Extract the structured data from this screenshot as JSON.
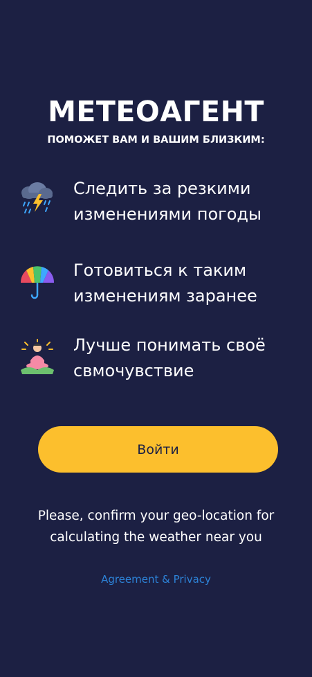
{
  "app": {
    "title": "МЕТЕОАГЕНТ",
    "subtitle": "ПОМОЖЕТ ВАМ И ВАШИМ БЛИЗКИМ:"
  },
  "features": [
    {
      "icon": "thunderstorm-cloud-icon",
      "label": "Следить за резкими изменениями погоды"
    },
    {
      "icon": "rainbow-umbrella-icon",
      "label": "Готовиться к таким изменениям заранее"
    },
    {
      "icon": "meditating-person-icon",
      "label": "Лучше понимать своё свмочувствие"
    }
  ],
  "actions": {
    "login_label": "Войти"
  },
  "geo_note": "Please, confirm your geo-location for calculating the weather near you",
  "agreement_link": "Agreement & Privacy",
  "colors": {
    "background": "#1c2043",
    "accent": "#fcbf2d",
    "link": "#2d83d8",
    "text": "#ffffff"
  }
}
